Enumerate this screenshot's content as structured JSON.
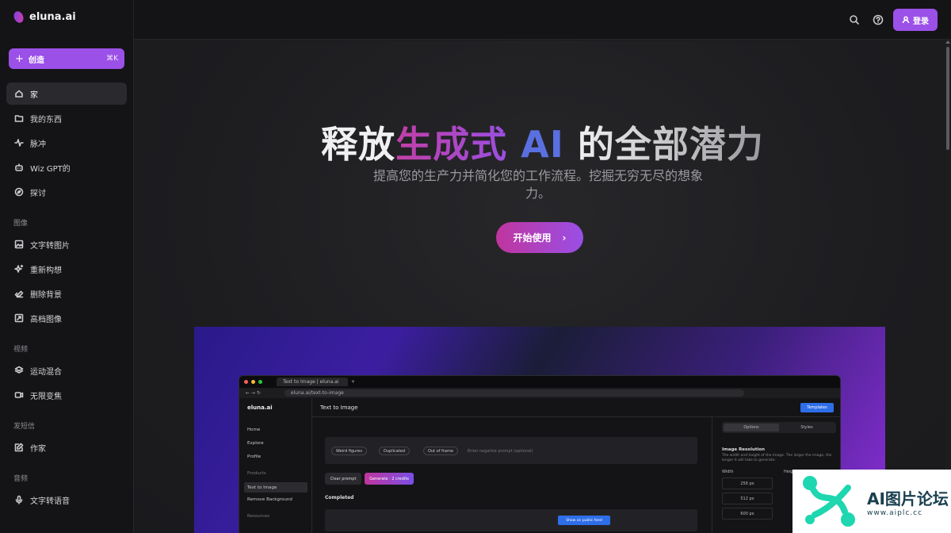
{
  "app": {
    "logo_text": "eluna.ai"
  },
  "sidebar": {
    "create": {
      "label": "创造",
      "shortcut": "⌘K"
    },
    "items": [
      {
        "label": "家",
        "icon": "home-icon"
      },
      {
        "label": "我的东西",
        "icon": "folder-icon"
      },
      {
        "label": "脉冲",
        "icon": "pulse-icon"
      },
      {
        "label": "Wiz GPT的",
        "icon": "bot-icon"
      },
      {
        "label": "探讨",
        "icon": "compass-icon"
      }
    ],
    "sections": [
      {
        "label": "图像",
        "items": [
          {
            "label": "文字转图片",
            "icon": "image-icon"
          },
          {
            "label": "重新构想",
            "icon": "sparkles-icon"
          },
          {
            "label": "删除背景",
            "icon": "eraser-icon"
          },
          {
            "label": "高档图像",
            "icon": "upscale-icon"
          }
        ]
      },
      {
        "label": "视频",
        "items": [
          {
            "label": "运动混合",
            "icon": "layers-icon"
          },
          {
            "label": "无限变焦",
            "icon": "video-icon"
          }
        ]
      },
      {
        "label": "发短信",
        "items": [
          {
            "label": "作家",
            "icon": "edit-icon"
          }
        ]
      },
      {
        "label": "音频",
        "items": [
          {
            "label": "文字转语音",
            "icon": "mic-icon"
          }
        ]
      }
    ]
  },
  "topbar": {
    "login_label": "登录"
  },
  "hero": {
    "title_part1": "释放",
    "title_part2": "生成式",
    "title_part3": "AI",
    "title_part4": "的全部潜力",
    "subtitle": "提高您的生产力并简化您的工作流程。挖掘无穷无尽的想象力。",
    "cta_label": "开始使用"
  },
  "showcase": {
    "tab_title": "Text to Image | eluna.ai",
    "url": "eluna.ai/text-to-image",
    "logo_text": "eluna.ai",
    "page_title": "Text to Image",
    "templates_label": "Templates",
    "nav": [
      "Home",
      "Explore",
      "Profile",
      "Products",
      "Text to Image",
      "Remove Background",
      "Resources"
    ],
    "chips": [
      "Weird figures",
      "Duplicated",
      "Out of frame"
    ],
    "negative_placeholder": "Enter negative prompt (optional)",
    "clear_label": "Clear prompt",
    "generate_label": "Generate · 2 credits",
    "completed_label": "Completed",
    "public_label": "Show on public feed",
    "options_tab": "Options",
    "styles_tab": "Styles",
    "resolution_title": "Image Resolution",
    "resolution_desc": "The width and height of the image. The larger the image, the longer it will take to generate.",
    "width_label": "Width",
    "height_label": "Heigh",
    "widths": [
      "256 px",
      "512 px",
      "600 px"
    ]
  },
  "watermark": {
    "title": "AI图片论坛",
    "url": "www.aiplc.cc"
  }
}
